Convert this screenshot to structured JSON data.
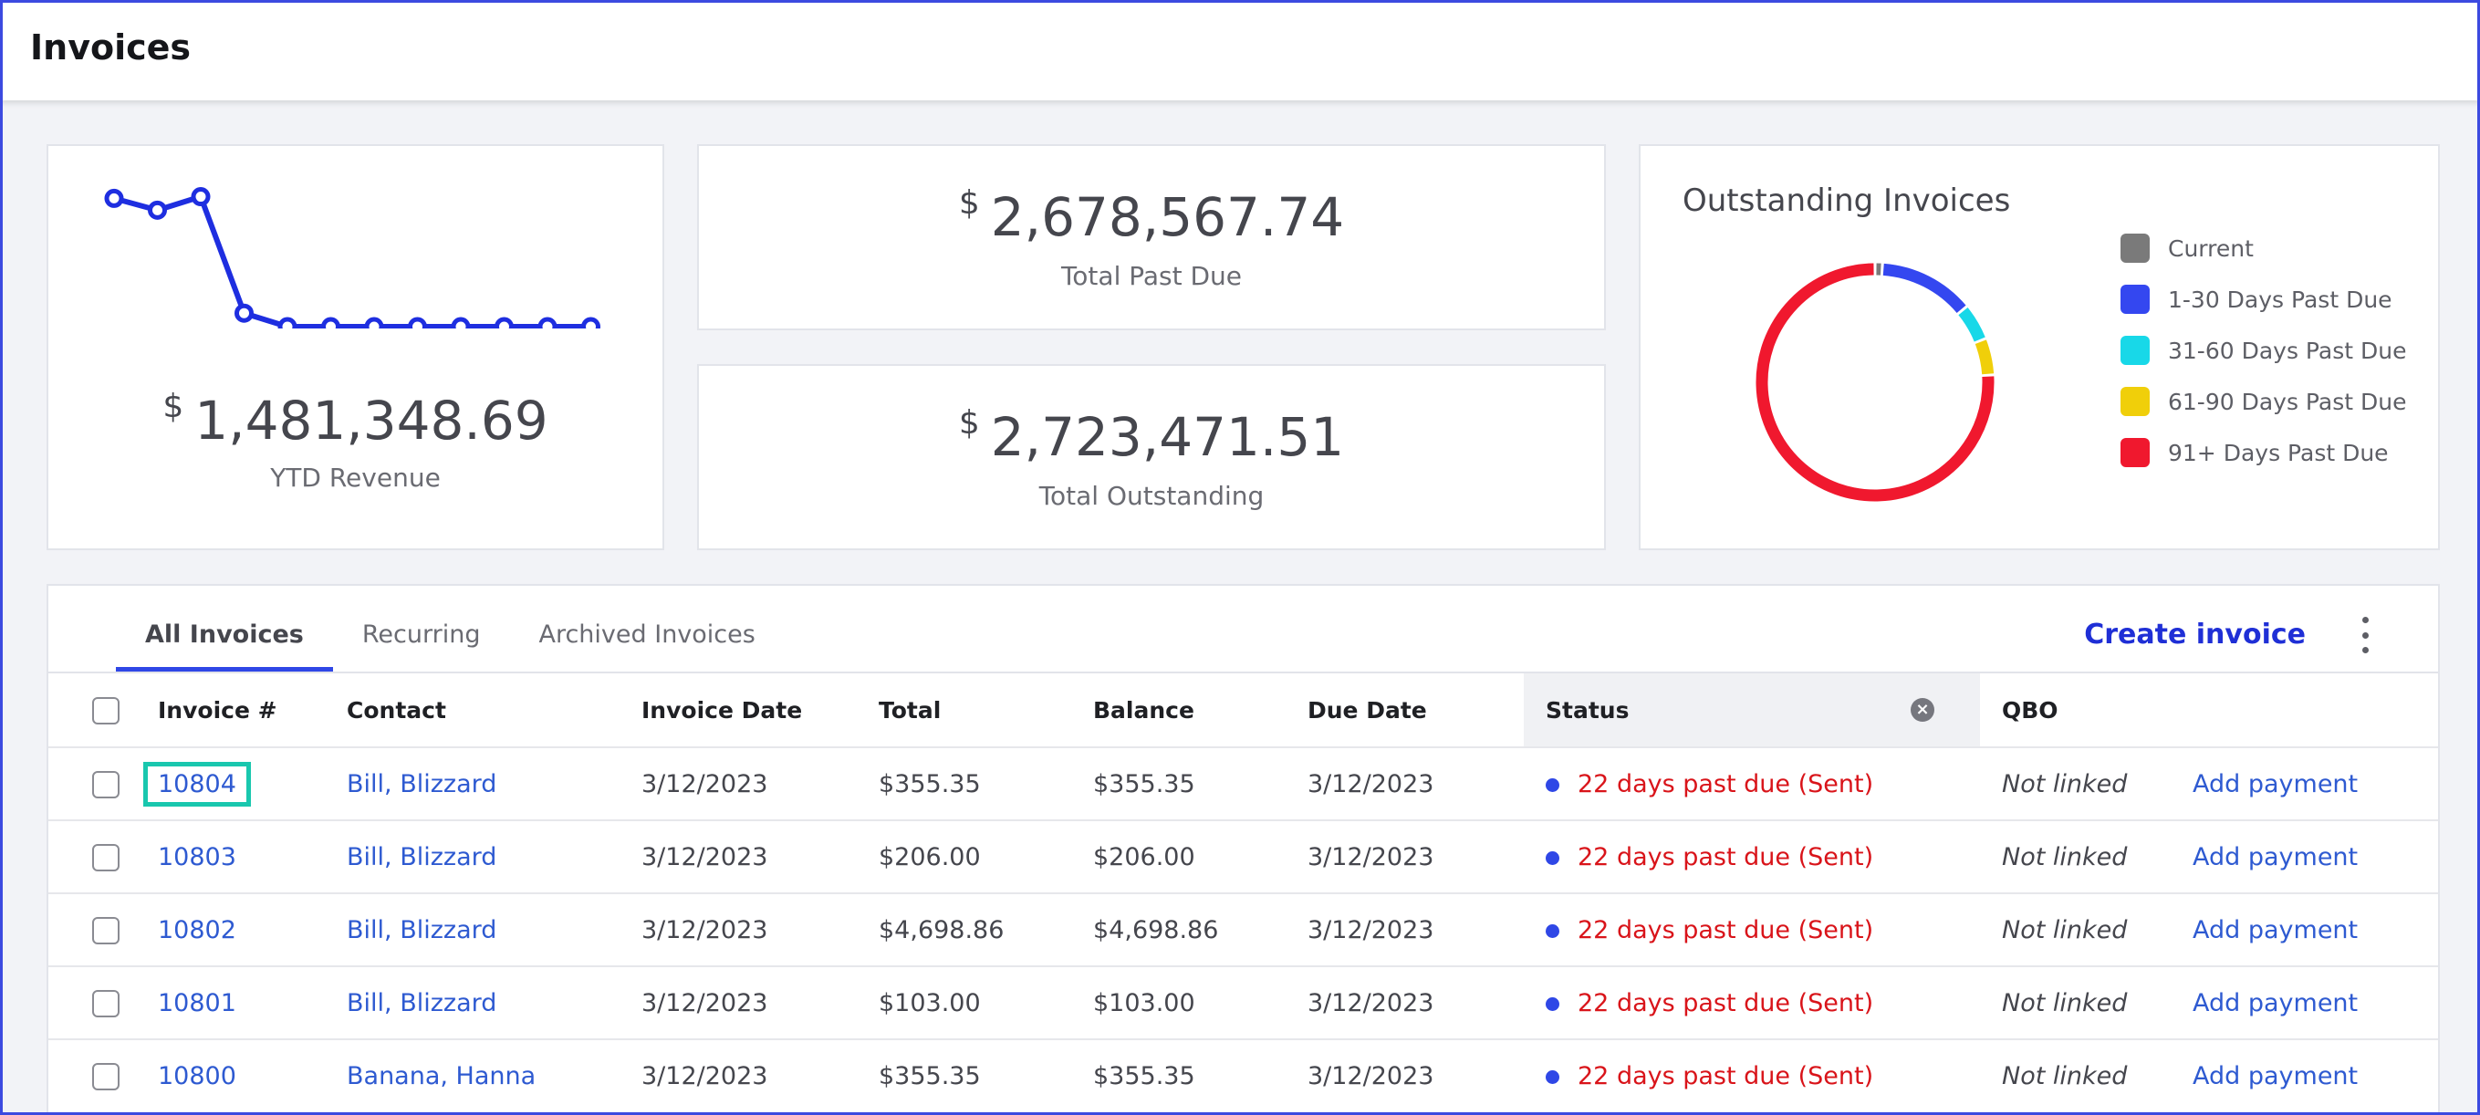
{
  "header": {
    "title": "Invoices"
  },
  "ytd": {
    "currency": "$",
    "amount": "1,481,348.69",
    "caption": "YTD Revenue",
    "line_color": "#1e2ee0",
    "trend_values": [
      0.96,
      0.89,
      0.97,
      0.28,
      0.2,
      0.2,
      0.2,
      0.2,
      0.2,
      0.2,
      0.2,
      0.2
    ]
  },
  "past_due": {
    "currency": "$",
    "amount": "2,678,567.74",
    "caption": "Total Past Due"
  },
  "outstanding": {
    "currency": "$",
    "amount": "2,723,471.51",
    "caption": "Total Outstanding"
  },
  "donut": {
    "title": "Outstanding Invoices",
    "segments": [
      {
        "label": "Current",
        "color": "#7a7a7a",
        "value": 1.0
      },
      {
        "label": "1-30 Days Past Due",
        "color": "#3447f0",
        "value": 13.0
      },
      {
        "label": "31-60 Days Past Due",
        "color": "#18d8e8",
        "value": 5.0
      },
      {
        "label": "61-90 Days Past Due",
        "color": "#f0cf0a",
        "value": 5.0
      },
      {
        "label": "91+ Days Past Due",
        "color": "#f0182e",
        "value": 76.0
      }
    ]
  },
  "tabs": [
    "All Invoices",
    "Recurring",
    "Archived Invoices"
  ],
  "actions": {
    "create": "Create invoice"
  },
  "table": {
    "headers": [
      "Invoice #",
      "Contact",
      "Invoice Date",
      "Total",
      "Balance",
      "Due Date",
      "Status",
      "QBO"
    ],
    "rows": [
      {
        "invoice": "10804",
        "contact": "Bill, Blizzard",
        "date": "3/12/2023",
        "total": "$355.35",
        "balance": "$355.35",
        "due": "3/12/2023",
        "status": "22 days past due (Sent)",
        "qbo": "Not linked",
        "action": "Add payment"
      },
      {
        "invoice": "10803",
        "contact": "Bill, Blizzard",
        "date": "3/12/2023",
        "total": "$206.00",
        "balance": "$206.00",
        "due": "3/12/2023",
        "status": "22 days past due (Sent)",
        "qbo": "Not linked",
        "action": "Add payment"
      },
      {
        "invoice": "10802",
        "contact": "Bill, Blizzard",
        "date": "3/12/2023",
        "total": "$4,698.86",
        "balance": "$4,698.86",
        "due": "3/12/2023",
        "status": "22 days past due (Sent)",
        "qbo": "Not linked",
        "action": "Add payment"
      },
      {
        "invoice": "10801",
        "contact": "Bill, Blizzard",
        "date": "3/12/2023",
        "total": "$103.00",
        "balance": "$103.00",
        "due": "3/12/2023",
        "status": "22 days past due (Sent)",
        "qbo": "Not linked",
        "action": "Add payment"
      },
      {
        "invoice": "10800",
        "contact": "Banana, Hanna",
        "date": "3/12/2023",
        "total": "$355.35",
        "balance": "$355.35",
        "due": "3/12/2023",
        "status": "22 days past due (Sent)",
        "qbo": "Not linked",
        "action": "Add payment"
      }
    ]
  }
}
